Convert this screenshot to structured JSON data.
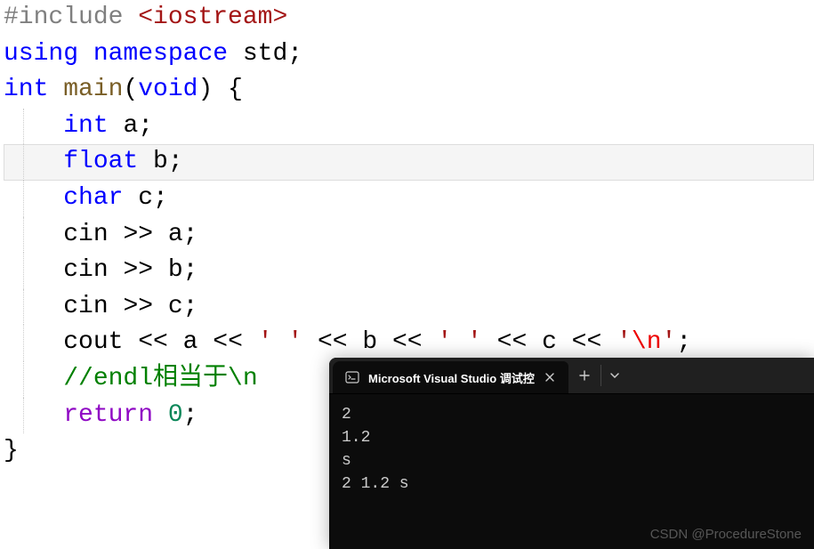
{
  "code": {
    "line1": {
      "pp": "#include ",
      "lib": "<iostream>"
    },
    "line2": {
      "kw1": "using ",
      "kw2": "namespace ",
      "ns": "std",
      "end": ";"
    },
    "line3": {
      "t1": "int ",
      "fn": "main",
      "p1": "(",
      "t2": "void",
      "p2": ") {"
    },
    "line4": {
      "indent": "    ",
      "t": "int ",
      "v": "a",
      "end": ";"
    },
    "line5": {
      "indent": "    ",
      "t": "float ",
      "v": "b",
      "end": ";"
    },
    "line6": {
      "indent": "    ",
      "t": "char ",
      "v": "c",
      "end": ";"
    },
    "line7": {
      "indent": "    ",
      "obj": "cin ",
      "op": ">> ",
      "v": "a",
      "end": ";"
    },
    "line8": {
      "indent": "    ",
      "obj": "cin ",
      "op": ">> ",
      "v": "b",
      "end": ";"
    },
    "line9": {
      "indent": "    ",
      "obj": "cin ",
      "op": ">> ",
      "v": "c",
      "end": ";"
    },
    "line10": {
      "indent": "    ",
      "obj": "cout ",
      "op1": "<< ",
      "v1": "a ",
      "op2": "<< ",
      "s1a": "'",
      "s1b": " ",
      "s1c": "'",
      "sp2": " ",
      "op3": "<< ",
      "v2": "b ",
      "op4": "<< ",
      "s2a": "'",
      "s2b": " ",
      "s2c": "'",
      "sp3": " ",
      "op5": "<< ",
      "v3": "c ",
      "op6": "<< ",
      "s3a": "'",
      "esc": "\\n",
      "s3c": "'",
      "end": ";"
    },
    "line11": {
      "indent": "    ",
      "cmt": "//endl相当于\\n"
    },
    "line12": {
      "indent": "    ",
      "kw": "return ",
      "num": "0",
      "end": ";"
    },
    "line13": {
      "brace": "}"
    }
  },
  "terminal": {
    "tab_title": "Microsoft Visual Studio 调试控",
    "output": [
      "2",
      "1.2",
      "s",
      "2 1.2 s"
    ]
  },
  "watermark": "CSDN @ProcedureStone"
}
